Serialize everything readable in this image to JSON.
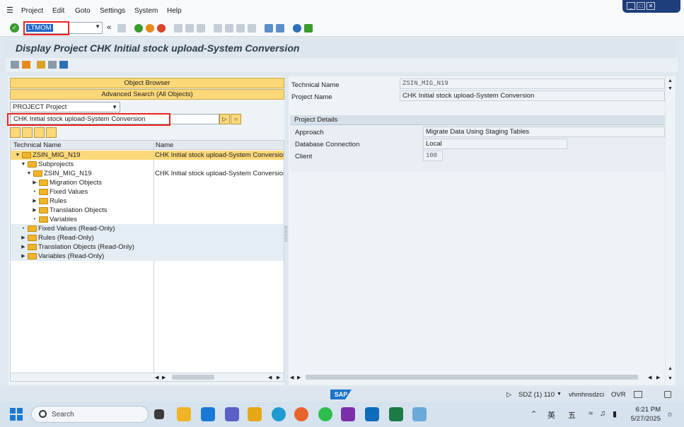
{
  "menu": {
    "items": [
      "Project",
      "Edit",
      "Goto",
      "Settings",
      "System",
      "Help"
    ]
  },
  "toolbar": {
    "command_field": "LTMOM"
  },
  "page_title": "Display Project CHK Initial stock upload-System Conversion",
  "left": {
    "object_browser": "Object Browser",
    "advanced_search": "Advanced Search (All Objects)",
    "project_type": "PROJECT  Project",
    "project_search": "CHK Initial stock upload-System Conversion",
    "tree": {
      "col_technical": "Technical Name",
      "col_name": "Name",
      "rows": [
        {
          "label": "ZSIN_MIG_N19",
          "name": "CHK Initial stock upload-System Conversion"
        },
        {
          "label": "Subprojects",
          "name": ""
        },
        {
          "label": "ZSIN_MIG_N19",
          "name": "CHK Initial stock upload-System Conversion"
        },
        {
          "label": "Migration Objects",
          "name": ""
        },
        {
          "label": "Fixed Values",
          "name": ""
        },
        {
          "label": "Rules",
          "name": ""
        },
        {
          "label": "Translation Objects",
          "name": ""
        },
        {
          "label": "Variables",
          "name": ""
        },
        {
          "label": "Fixed Values (Read-Only)",
          "name": ""
        },
        {
          "label": "Rules (Read-Only)",
          "name": ""
        },
        {
          "label": "Translation Objects (Read-Only)",
          "name": ""
        },
        {
          "label": "Variables (Read-Only)",
          "name": ""
        }
      ]
    }
  },
  "right": {
    "technical_name_label": "Technical Name",
    "technical_name_value": "ZSIN_MIG_N19",
    "project_name_label": "Project Name",
    "project_name_value": "CHK Initial stock upload-System Conversion",
    "details_header": "Project Details",
    "approach_label": "Approach",
    "approach_value": "Migrate Data Using Staging Tables",
    "db_label": "Database Connection",
    "db_value": "Local",
    "client_label": "Client",
    "client_value": "100"
  },
  "status": {
    "logo": "SAP",
    "system": "SDZ (1) 110",
    "host": "vhmhnsdzci",
    "mode": "OVR"
  },
  "taskbar": {
    "search_placeholder": "Search",
    "ime1": "英",
    "ime2": "五",
    "time": "6:21 PM",
    "date": "5/27/2025"
  },
  "colors": {
    "accent_yellow": "#fcd878",
    "selection_blue": "#1e66c9",
    "highlight_red": "#ee2222"
  }
}
